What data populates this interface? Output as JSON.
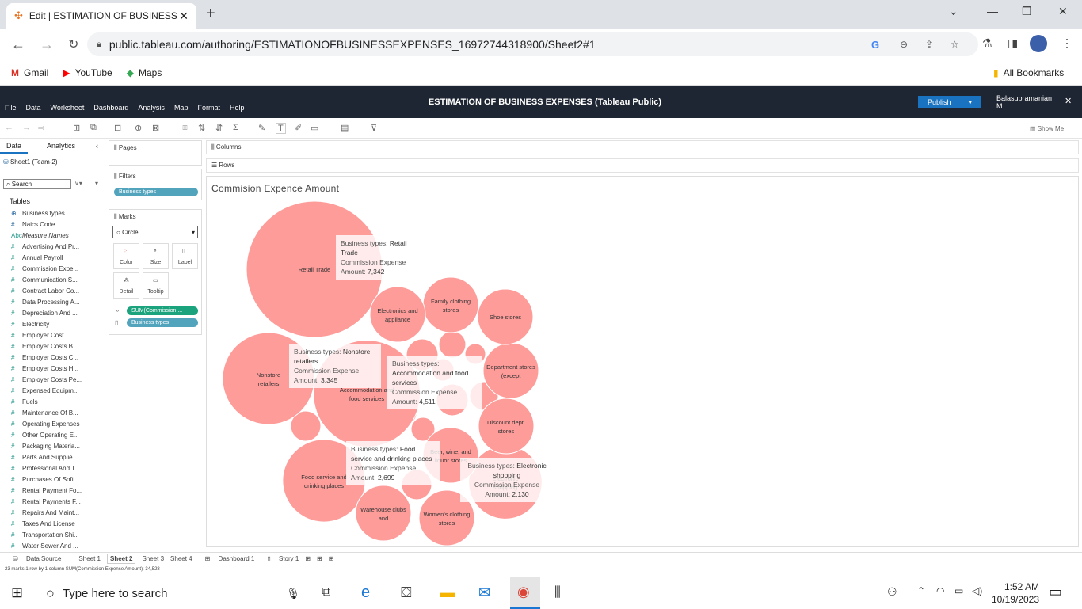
{
  "browser": {
    "tab_title": "Edit | ESTIMATION OF BUSINESS",
    "url": "public.tableau.com/authoring/ESTIMATIONOFBUSINESSEXPENSES_16972744318900/Sheet2#1",
    "bookmarks": [
      "Gmail",
      "YouTube",
      "Maps"
    ],
    "all_bookmarks": "All Bookmarks"
  },
  "tableau": {
    "menu": [
      "File",
      "Data",
      "Worksheet",
      "Dashboard",
      "Analysis",
      "Map",
      "Format",
      "Help"
    ],
    "title": "ESTIMATION OF BUSINESS EXPENSES (Tableau Public)",
    "publish": "Publish",
    "user": "Balasubramanian M",
    "show_me": "Show Me",
    "left_tabs": [
      "Data",
      "Analytics"
    ],
    "datasource": "Sheet1 (Team-2)",
    "search_placeholder": "Search",
    "tables_label": "Tables",
    "fields": [
      "Business types",
      "Naics Code",
      "Measure Names",
      "Advertising And Pr...",
      "Annual Payroll",
      "Commission Expe...",
      "Communication S...",
      "Contract Labor Co...",
      "Data Processing A...",
      "Depreciation And ...",
      "Electricity",
      "Employer Cost",
      "Employer Costs B...",
      "Employer Costs C...",
      "Employer Costs H...",
      "Employer Costs Pe...",
      "Expensed Equipm...",
      "Fuels",
      "Maintenance Of B...",
      "Operating Expenses",
      "Other Operating E...",
      "Packaging Materia...",
      "Parts And Supplie...",
      "Professional And T...",
      "Purchases Of Soft...",
      "Rental Payment Fo...",
      "Rental Payments F...",
      "Repairs And Maint...",
      "Taxes And License",
      "Transportation Shi...",
      "Water Sewer And ..."
    ],
    "pages_label": "Pages",
    "filters_label": "Filters",
    "filter_pill": "Business types",
    "marks_label": "Marks",
    "mark_type": "Circle",
    "mark_buttons": [
      "Color",
      "Size",
      "Label",
      "Detail",
      "Tooltip"
    ],
    "mark_pills": [
      "SUM(Commission ...",
      "Business types"
    ],
    "columns_label": "Columns",
    "rows_label": "Rows",
    "sheet_title": "Commision  Expence Amount",
    "sheet_tabs": [
      "Data Source",
      "Sheet 1",
      "Sheet 2",
      "Sheet 3",
      "Sheet 4",
      "Dashboard 1",
      "Story 1"
    ],
    "status": "23 marks   1 row by 1 column    SUM(Commission Expense Amount): 34,528"
  },
  "chart_data": {
    "type": "bubble",
    "title": "Commision  Expence Amount",
    "color": "#fe9c9a",
    "bubbles": [
      {
        "label": "Retail Trade",
        "value": 7342
      },
      {
        "label": "Accommodation and food services",
        "value": 4511
      },
      {
        "label": "Nonstore retailers",
        "value": 3345
      },
      {
        "label": "Food service and drinking places",
        "value": 2699
      },
      {
        "label": "Electronic shopping",
        "value": 2130
      },
      {
        "label": "Women's clothing stores"
      },
      {
        "label": "Warehouse clubs and"
      },
      {
        "label": "Beer, wine, and liquor stores"
      },
      {
        "label": "Discount dept. stores"
      },
      {
        "label": "Department stores (except"
      },
      {
        "label": "Shoe stores"
      },
      {
        "label": "Family clothing stores"
      },
      {
        "label": "Electronics and appliance"
      }
    ],
    "tooltips": [
      {
        "type_label": "Business types:",
        "type": "Retail Trade",
        "measure": "Commission Expense Amount:",
        "value": "7,342"
      },
      {
        "type_label": "Business types:",
        "type": "Nonstore retailers",
        "measure": "Commission Expense Amount:",
        "value": "3,345"
      },
      {
        "type_label": "Business types:",
        "type": "Accommodation and food services",
        "measure": "Commission Expense Amount:",
        "value": "4,511"
      },
      {
        "type_label": "Business types:",
        "type": "Food service and drinking places",
        "measure": "Commission Expense Amount:",
        "value": "2,699"
      },
      {
        "type_label": "Business types:",
        "type": "Electronic shopping",
        "measure": "Commission Expense Amount:",
        "value": "2,130"
      }
    ]
  },
  "taskbar": {
    "search_placeholder": "Type here to search",
    "time": "1:52 AM",
    "date": "10/19/2023"
  }
}
